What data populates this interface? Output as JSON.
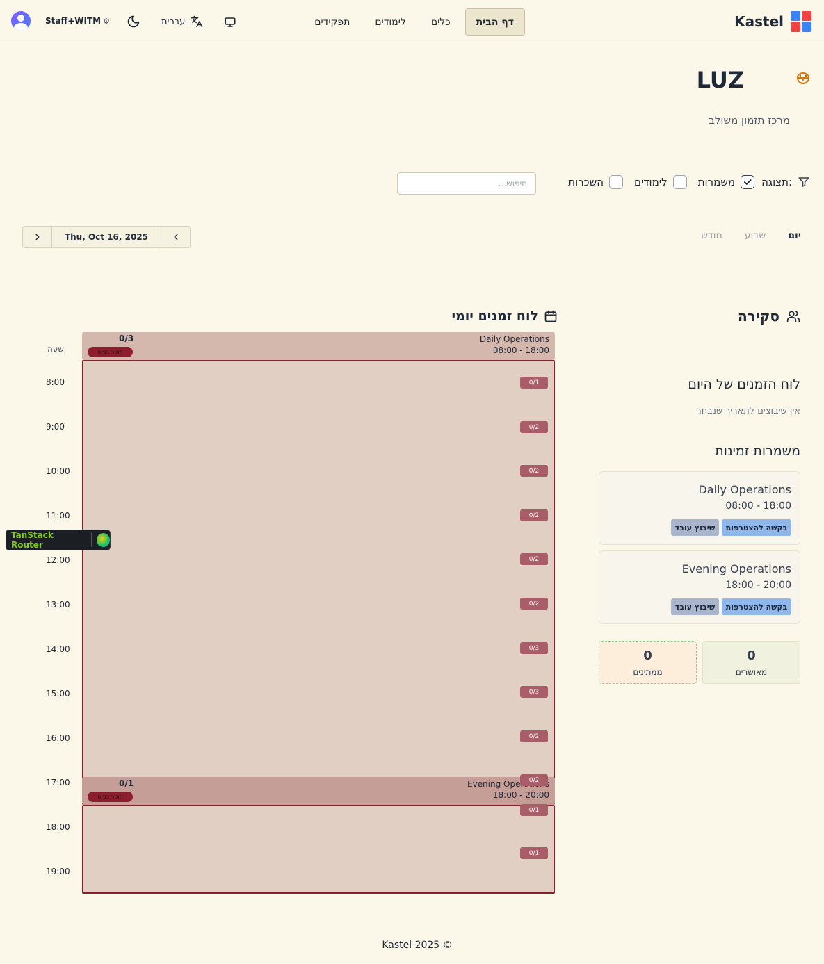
{
  "header": {
    "logo_text": "Kastel",
    "logo_colors": [
      "#3b82f6",
      "#ef4444",
      "#ef4444",
      "#3b82f6"
    ],
    "nav": [
      {
        "label": "דף הבית",
        "active": true
      },
      {
        "label": "כלים",
        "active": false
      },
      {
        "label": "לימודים",
        "active": false
      },
      {
        "label": "תפקידים",
        "active": false
      }
    ],
    "user_label": "Staff+WITM",
    "language_label": "עברית"
  },
  "page": {
    "title": "LUZ",
    "subtitle": "מרכז תזמון משולב"
  },
  "filters": {
    "label": "תצוגה:",
    "options": [
      {
        "label": "משמרות",
        "checked": true
      },
      {
        "label": "לימודים",
        "checked": false
      },
      {
        "label": "השכרות",
        "checked": false
      }
    ],
    "search_placeholder": "חיפוש..."
  },
  "views": {
    "tabs": [
      {
        "label": "יום",
        "active": true
      },
      {
        "label": "שבוע",
        "active": false
      },
      {
        "label": "חודש",
        "active": false
      }
    ],
    "current_date": "Thu, Oct 16, 2025"
  },
  "schedule": {
    "title": "לוח זמנים יומי",
    "time_header": "שעה",
    "hours": [
      "8:00",
      "9:00",
      "10:00",
      "11:00",
      "12:00",
      "13:00",
      "14:00",
      "15:00",
      "16:00",
      "17:00",
      "18:00",
      "19:00"
    ],
    "shifts": [
      {
        "name": "Daily Operations",
        "time": "08:00 - 18:00",
        "count": "0/3",
        "status": "חוסר בגיוס",
        "slots": [
          "0/1",
          "0/2",
          "0/2",
          "0/2",
          "0/2",
          "0/2",
          "0/3",
          "0/3",
          "0/2",
          "0/2"
        ]
      },
      {
        "name": "Evening Operations",
        "time": "18:00 - 20:00",
        "count": "0/1",
        "status": "חוסר בגיוס",
        "slots": [
          "0/1",
          "0/1"
        ]
      }
    ],
    "colors": {
      "shift_header_1": "#d4b7ad",
      "shift_body": "#e2cfc4",
      "shift_header_2": "#c59e97",
      "accent": "#8b1d2c"
    }
  },
  "devtools": {
    "label": "TanStack Router"
  },
  "overview": {
    "title": "סקירה",
    "today_title": "לוח הזמנים של היום",
    "today_empty": "אין שיבוצים לתאריך שנבחר",
    "temp_title": "משמרות זמינות",
    "cards": [
      {
        "name": "Daily Operations",
        "time": "08:00 - 18:00",
        "join_label": "בקשה להצטרפות",
        "assign_label": "שיבוץ עובד"
      },
      {
        "name": "Evening Operations",
        "time": "18:00 - 20:00",
        "join_label": "בקשה להצטרפות",
        "assign_label": "שיבוץ עובד"
      }
    ],
    "stats": [
      {
        "value": "0",
        "label": "מאושרים",
        "color": "#f1f1df"
      },
      {
        "value": "0",
        "label": "ממתינים",
        "color": "#fdeedb"
      }
    ]
  },
  "footer": {
    "text": "Kastel 2025 ©"
  }
}
